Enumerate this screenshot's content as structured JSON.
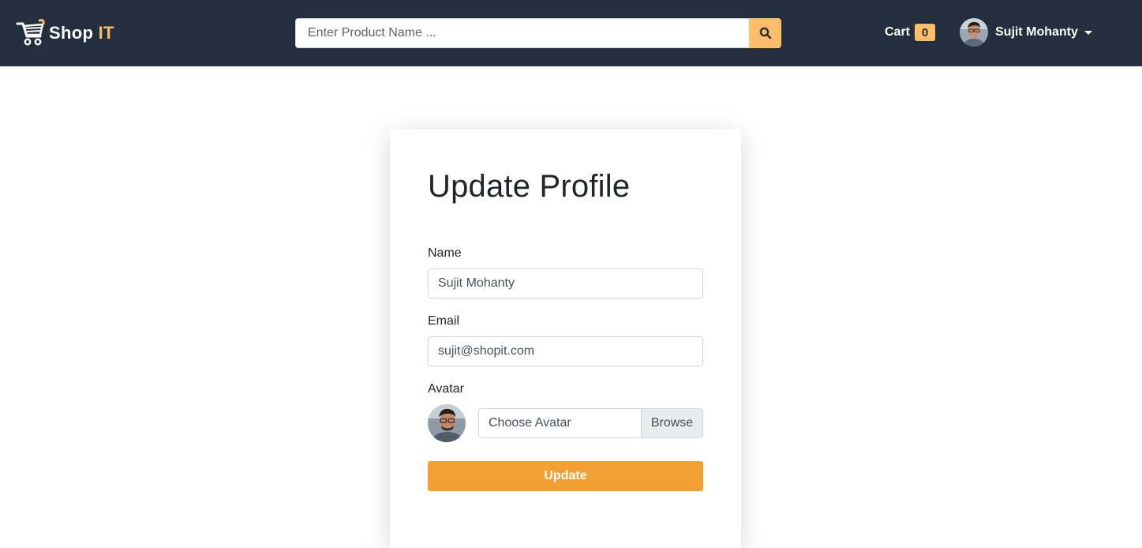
{
  "brand": {
    "name_main": "Shop",
    "name_accent": "IT",
    "accent_color": "#febd69",
    "logo_icon": "shopping-cart-icon"
  },
  "search": {
    "placeholder": "Enter Product Name ...",
    "value": "",
    "button_icon": "search-icon"
  },
  "cart": {
    "label": "Cart",
    "count": "0"
  },
  "user": {
    "name": "Sujit Mohanty",
    "avatar_icon": "user-avatar",
    "menu_icon": "caret-down-icon"
  },
  "profile_form": {
    "title": "Update Profile",
    "name_label": "Name",
    "name_value": "Sujit Mohanty",
    "email_label": "Email",
    "email_value": "sujit@shopit.com",
    "avatar_label": "Avatar",
    "avatar_file_label": "Choose Avatar",
    "browse_label": "Browse",
    "submit_label": "Update"
  },
  "colors": {
    "navbar": "#232f3e",
    "accent": "#febd69",
    "button": "#f3a033"
  }
}
